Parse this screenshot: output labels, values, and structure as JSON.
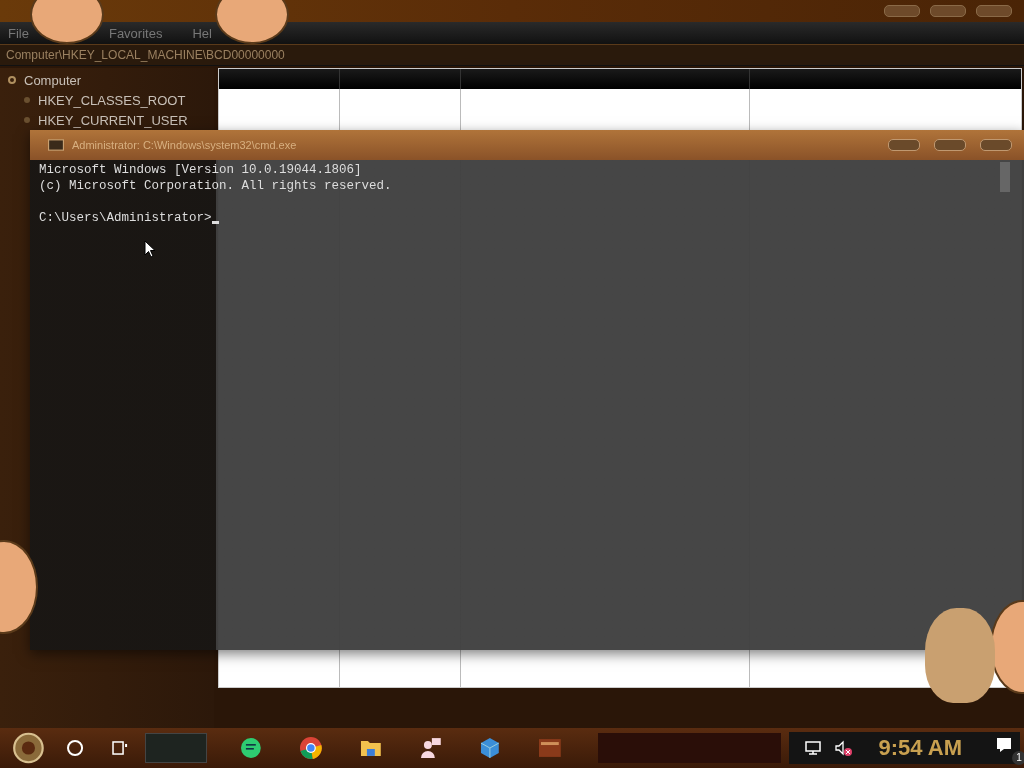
{
  "regedit": {
    "menu": [
      "File",
      "Favorites",
      "Hel"
    ],
    "address": "Computer\\HKEY_LOCAL_MACHINE\\BCD00000000",
    "tree": {
      "label": "Computer",
      "expanded": true,
      "children": [
        {
          "label": "HKEY_CLASSES_ROOT",
          "expanded": false
        },
        {
          "label": "HKEY_CURRENT_USER",
          "expanded": false
        }
      ]
    }
  },
  "cmd": {
    "title": "Administrator: C:\\Windows\\system32\\cmd.exe",
    "lines": [
      "Microsoft Windows [Version 10.0.19044.1806]",
      "(c) Microsoft Corporation. All rights reserved."
    ],
    "prompt": "C:\\Users\\Administrator>"
  },
  "taskbar": {
    "apps": [
      {
        "kind": "messages"
      },
      {
        "kind": "browser"
      },
      {
        "kind": "folder"
      },
      {
        "kind": "people"
      },
      {
        "kind": "cube"
      },
      {
        "kind": "thumbnail"
      }
    ],
    "volume_muted": true,
    "clock": "9:54 AM",
    "notification_count": "1"
  }
}
